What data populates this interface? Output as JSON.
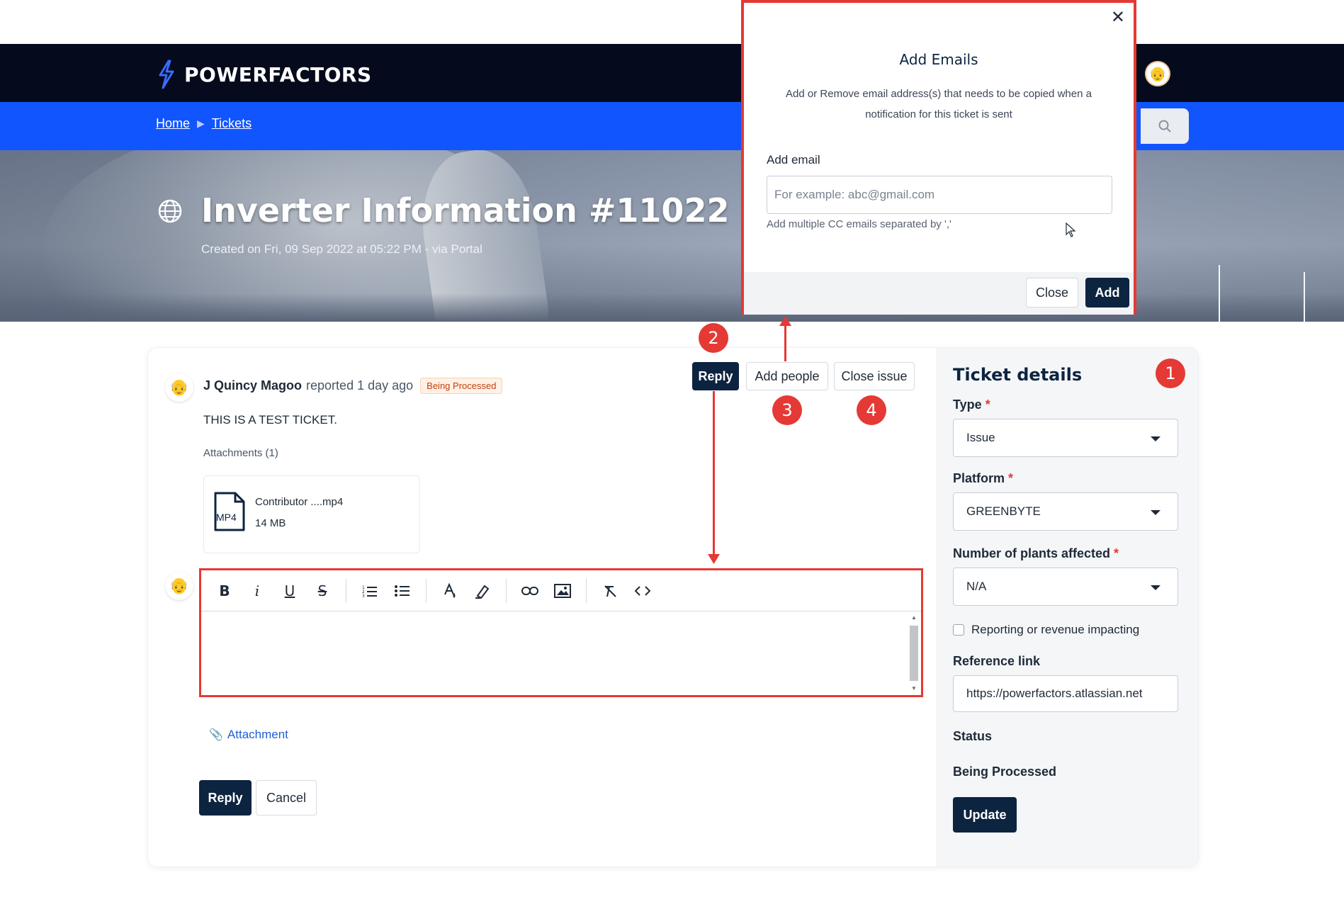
{
  "header": {
    "brand": "POWERFACTORS",
    "breadcrumbs": [
      "Home",
      "Tickets"
    ],
    "avatar_emoji": "👴"
  },
  "hero": {
    "title": "Inverter Information #11022",
    "subtitle": "Created on Fri, 09 Sep 2022 at 05:22 PM - via Portal"
  },
  "ticket": {
    "reporter_name": "J Quincy Magoo",
    "reported_text": "reported 1 day ago",
    "status_badge": "Being Processed",
    "body": "THIS IS A TEST TICKET.",
    "attachments_label": "Attachments (1)",
    "file": {
      "name": "Contributor ....mp4",
      "size": "14 MB",
      "type": "MP4"
    },
    "actions": {
      "reply": "Reply",
      "add_people": "Add people",
      "close_issue": "Close issue"
    }
  },
  "reply_form": {
    "attachment_link": "Attachment",
    "reply_label": "Reply",
    "cancel_label": "Cancel"
  },
  "ticket_details": {
    "title": "Ticket details",
    "type_label": "Type",
    "type_value": "Issue",
    "platform_label": "Platform",
    "platform_value": "GREENBYTE",
    "plants_label": "Number of plants affected",
    "plants_value": "N/A",
    "reporting_label": "Reporting or revenue impacting",
    "reference_label": "Reference link",
    "reference_value": "https://powerfactors.atlassian.net",
    "status_label": "Status",
    "status_value": "Being Processed",
    "update_label": "Update",
    "required_mark": "*"
  },
  "modal": {
    "title": "Add Emails",
    "description": "Add or Remove email address(s) that needs to be copied when a notification for this ticket is sent",
    "field_label": "Add email",
    "placeholder": "For example: abc@gmail.com",
    "help": "Add multiple CC emails separated by ','",
    "close_label": "Close",
    "add_label": "Add",
    "close_glyph": "✕"
  },
  "markers": [
    "1",
    "2",
    "3",
    "4"
  ],
  "colors": {
    "brand_dark": "#050b1c",
    "brand_blue": "#1155ff",
    "button_dark": "#0d2440",
    "annotation_red": "#e53935"
  }
}
